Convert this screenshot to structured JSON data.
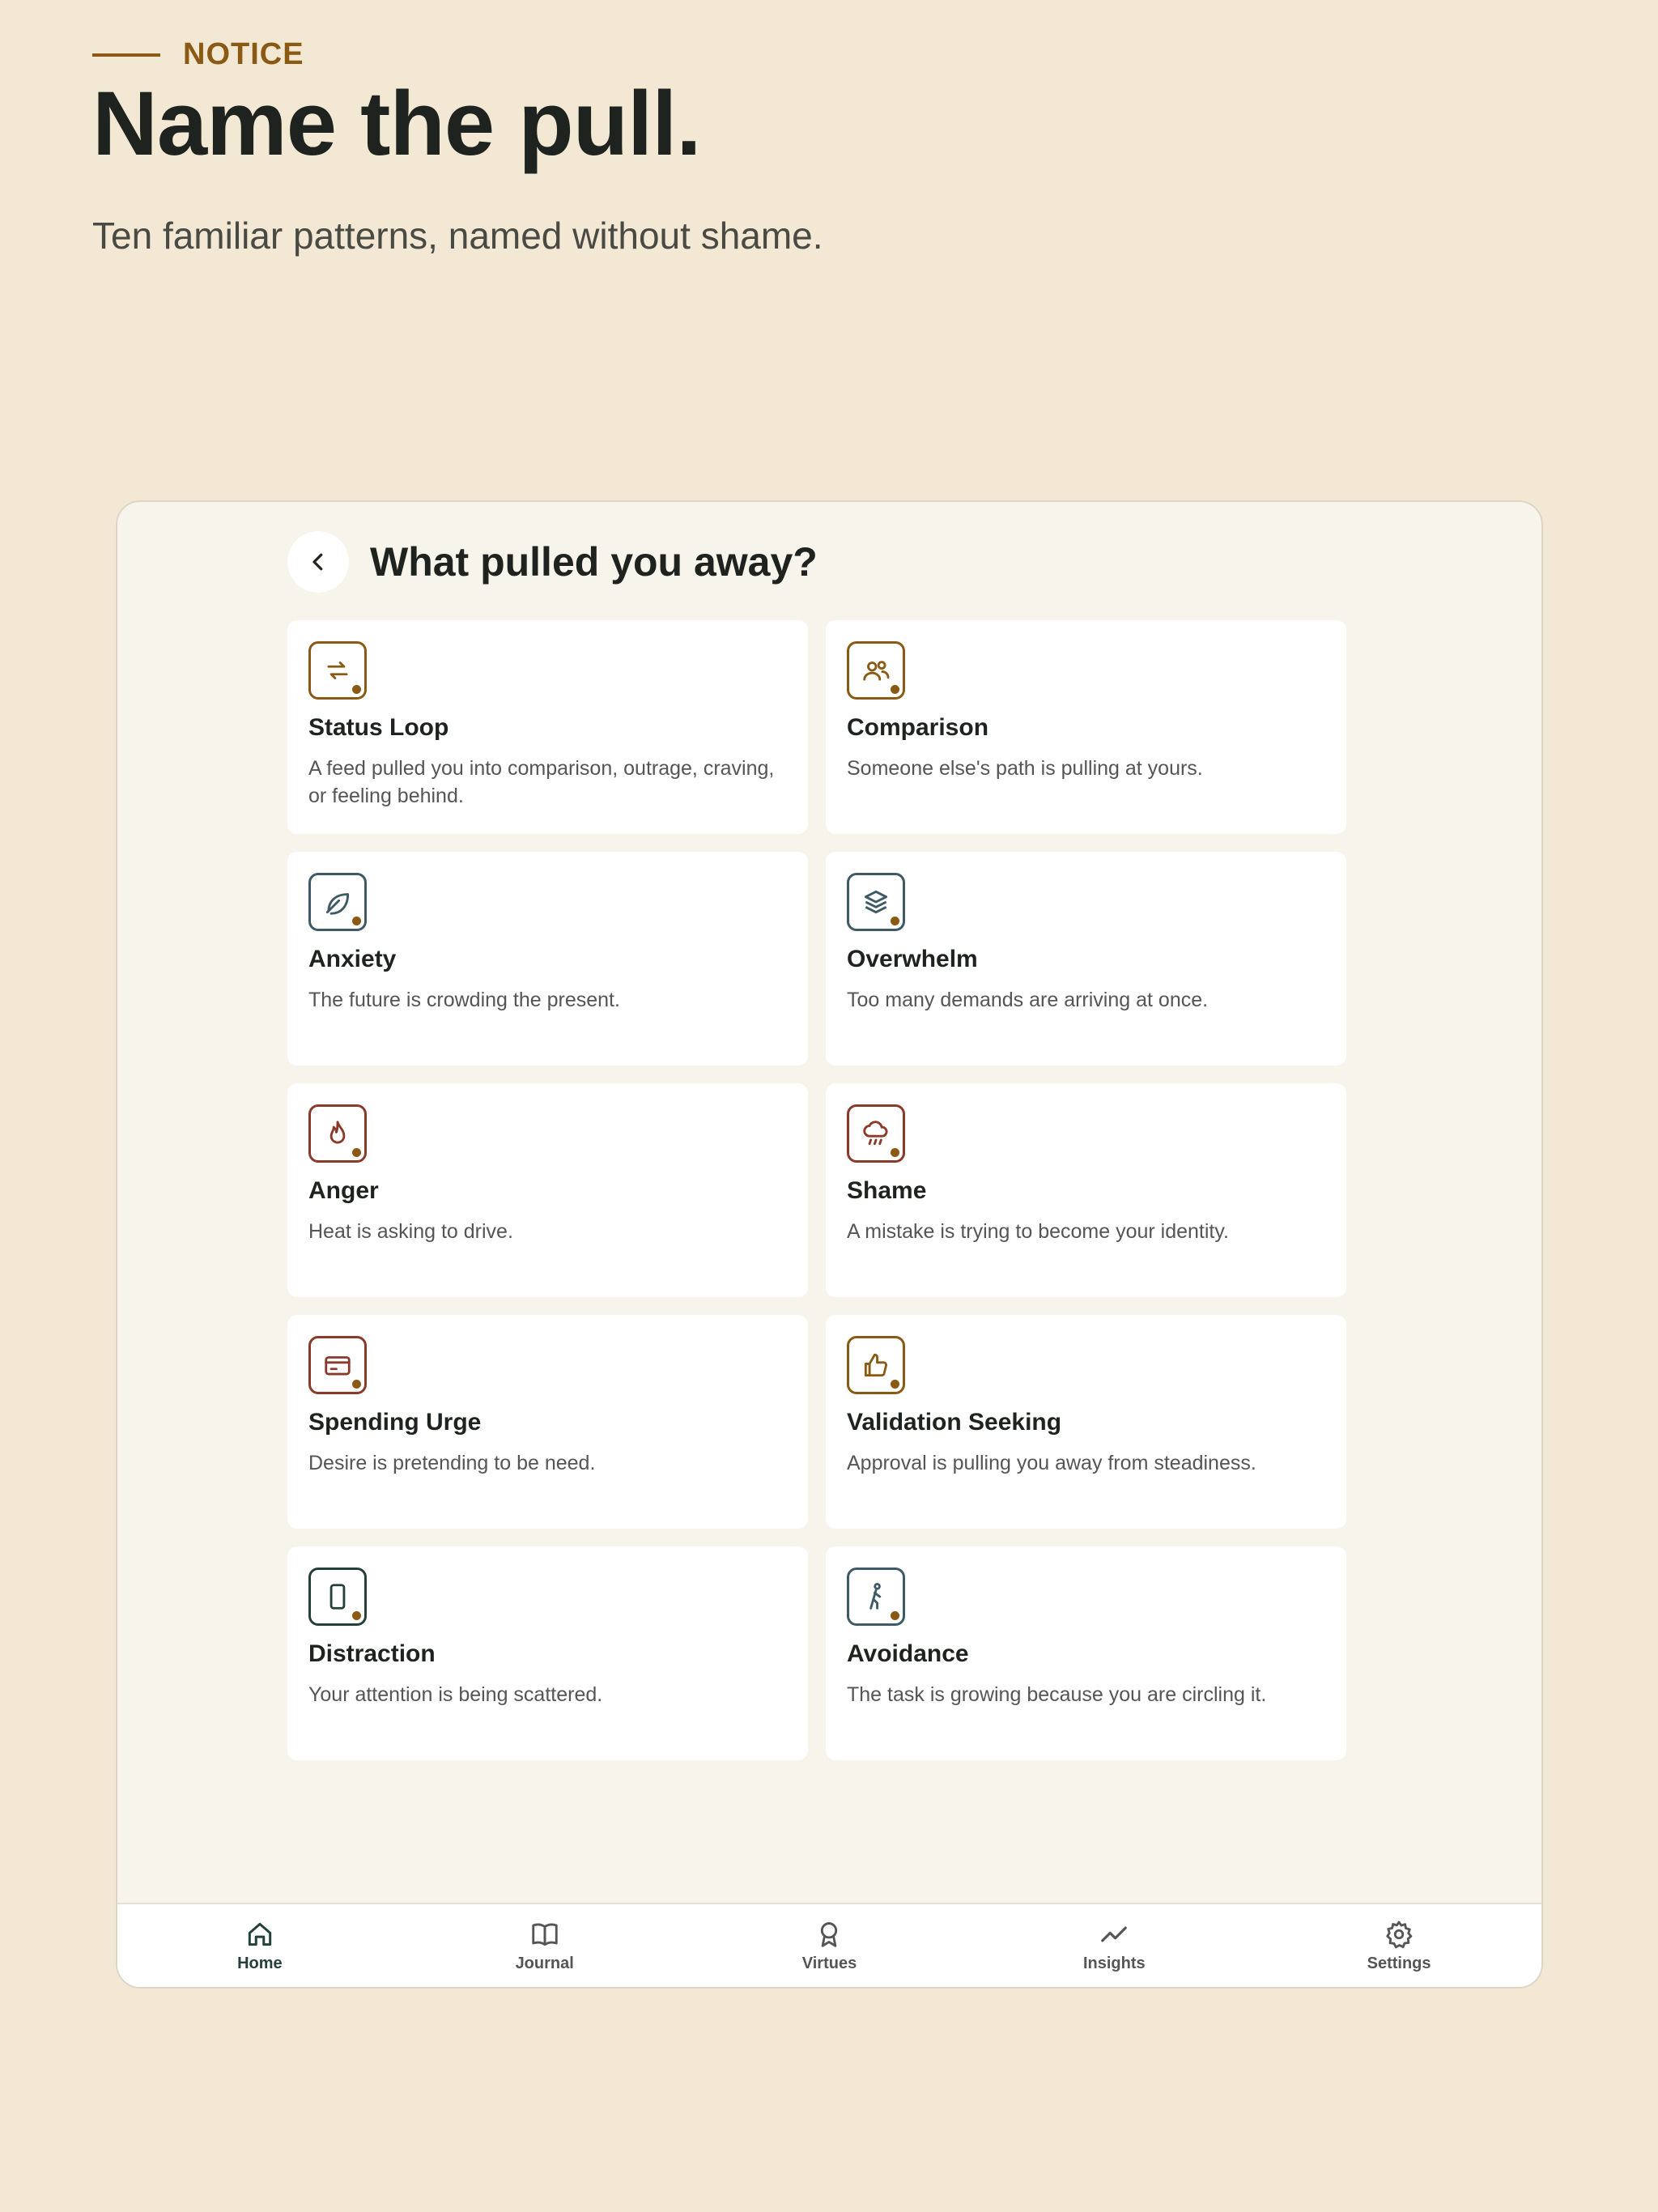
{
  "kicker": "NOTICE",
  "headline": "Name the pull.",
  "subhead": "Ten familiar patterns, named without shame.",
  "screen": {
    "title": "What pulled you away?",
    "back_icon": "chevron-left-icon"
  },
  "cards": [
    {
      "title": "Status Loop",
      "desc": "A feed pulled you into comparison, outrage, craving, or feeling behind.",
      "icon": "repeat-arrows-icon",
      "color": "#8a5a14"
    },
    {
      "title": "Comparison",
      "desc": "Someone else's path is pulling at yours.",
      "icon": "people-icon",
      "color": "#8a5a14"
    },
    {
      "title": "Anxiety",
      "desc": "The future is crowding the present.",
      "icon": "leaf-icon",
      "color": "#3d5a66"
    },
    {
      "title": "Overwhelm",
      "desc": "Too many demands are arriving at once.",
      "icon": "layers-icon",
      "color": "#3d5a66"
    },
    {
      "title": "Anger",
      "desc": "Heat is asking to drive.",
      "icon": "flame-icon",
      "color": "#8a3a2a"
    },
    {
      "title": "Shame",
      "desc": "A mistake is trying to become your identity.",
      "icon": "rain-cloud-icon",
      "color": "#8a3a2a"
    },
    {
      "title": "Spending Urge",
      "desc": "Desire is pretending to be need.",
      "icon": "credit-card-icon",
      "color": "#8a3a2a"
    },
    {
      "title": "Validation Seeking",
      "desc": "Approval is pulling you away from steadiness.",
      "icon": "thumbs-up-icon",
      "color": "#8a5a14"
    },
    {
      "title": "Distraction",
      "desc": "Your attention is being scattered.",
      "icon": "phone-icon",
      "color": "#24403a"
    },
    {
      "title": "Avoidance",
      "desc": "The task is growing because you are circling it.",
      "icon": "walking-person-icon",
      "color": "#3d5a66"
    }
  ],
  "tabs": [
    {
      "label": "Home",
      "icon": "home-icon",
      "active": true
    },
    {
      "label": "Journal",
      "icon": "book-icon",
      "active": false
    },
    {
      "label": "Virtues",
      "icon": "award-icon",
      "active": false
    },
    {
      "label": "Insights",
      "icon": "trend-line-icon",
      "active": false
    },
    {
      "label": "Settings",
      "icon": "gear-icon",
      "active": false
    }
  ],
  "colors": {
    "background": "#f3e8d3",
    "accent": "#8a5a14",
    "dark_green": "#24403a"
  }
}
